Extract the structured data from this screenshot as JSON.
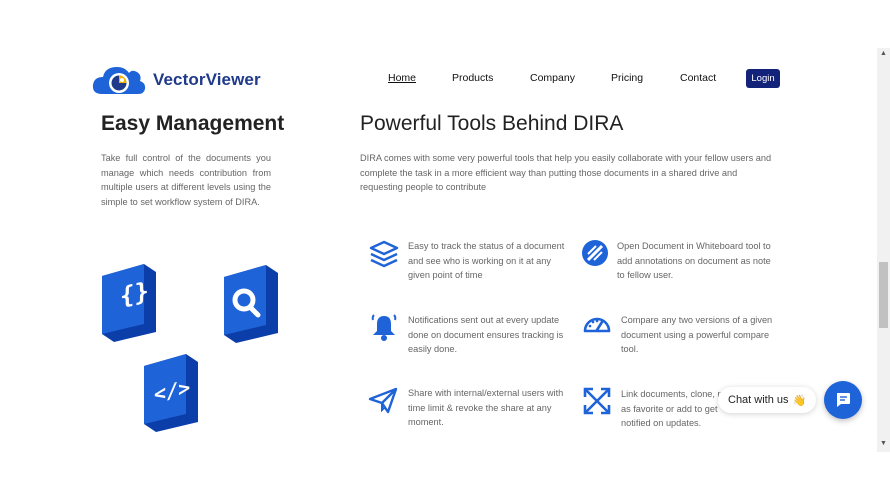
{
  "header": {
    "brand": "VectorViewer",
    "nav": [
      "Home",
      "Products",
      "Company",
      "Pricing",
      "Contact"
    ],
    "login_label": "Login"
  },
  "left": {
    "title": "Easy Management",
    "description": "Take full control of the documents you manage which needs contribution from multiple users at different levels using the simple to set workflow system of DIRA."
  },
  "right": {
    "title": "Powerful Tools Behind DIRA",
    "description": "DIRA comes with some very powerful tools that help you easily collaborate with your fellow users and complete the task in a more efficient way than putting those documents in a shared drive and requesting people to contribute",
    "features": [
      {
        "icon": "layers-icon",
        "text": "Easy to track the status of a document and see who is working on it at any given point of time"
      },
      {
        "icon": "whiteboard-pen-icon",
        "text": "Open Document in Whiteboard tool to add annotations on document as note to fellow user."
      },
      {
        "icon": "bell-icon",
        "text": "Notifications sent out at every update done on document ensures tracking is easily done."
      },
      {
        "icon": "speedometer-icon",
        "text": "Compare any two versions of a given document using a powerful compare tool."
      },
      {
        "icon": "paper-plane-icon",
        "text": "Share with internal/external users with time limit & revoke the share at any moment."
      },
      {
        "icon": "expand-arrows-icon",
        "text": "Link documents, clone, mark as favorite or add to get notified on updates."
      }
    ]
  },
  "chat": {
    "label": "Chat with us",
    "emoji": "👋"
  },
  "colors": {
    "brand_blue": "#1f3a8a",
    "icon_blue": "#1e63d8",
    "login_bg": "#14237a"
  }
}
